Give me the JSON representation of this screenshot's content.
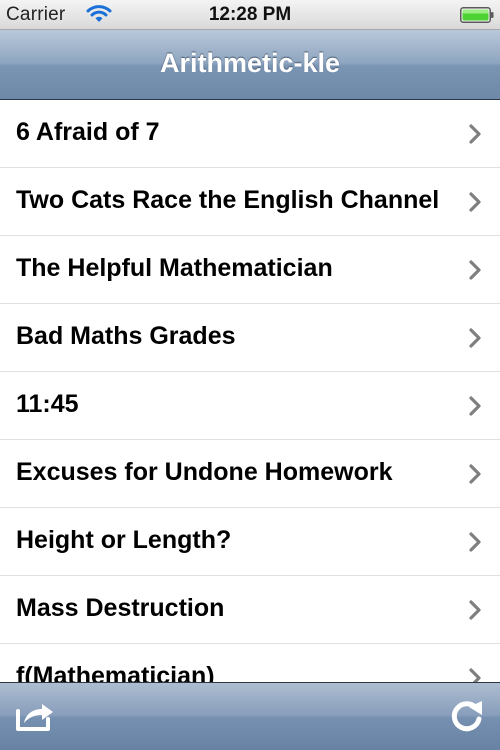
{
  "status_bar": {
    "carrier": "Carrier",
    "time": "12:28 PM",
    "wifi_icon": "wifi-icon",
    "battery_icon": "battery-icon"
  },
  "nav": {
    "title": "Arithmetic-kle"
  },
  "list": {
    "items": [
      {
        "label": "6 Afraid of 7"
      },
      {
        "label": "Two Cats Race the English Channel"
      },
      {
        "label": "The Helpful Mathematician"
      },
      {
        "label": "Bad Maths Grades"
      },
      {
        "label": "11:45"
      },
      {
        "label": "Excuses for Undone Homework"
      },
      {
        "label": "Height or Length?"
      },
      {
        "label": "Mass Destruction"
      },
      {
        "label": "f(Mathematician)"
      }
    ],
    "accessory_icon": "chevron-right-icon"
  },
  "toolbar": {
    "left_icon": "share-icon",
    "right_icon": "refresh-icon"
  },
  "colors": {
    "nav_bar": "#7a94b3",
    "toolbar": "#7590b0",
    "battery_fill": "#4cd232",
    "chevron": "#7f7f7f",
    "separator": "#e0e0e0"
  }
}
